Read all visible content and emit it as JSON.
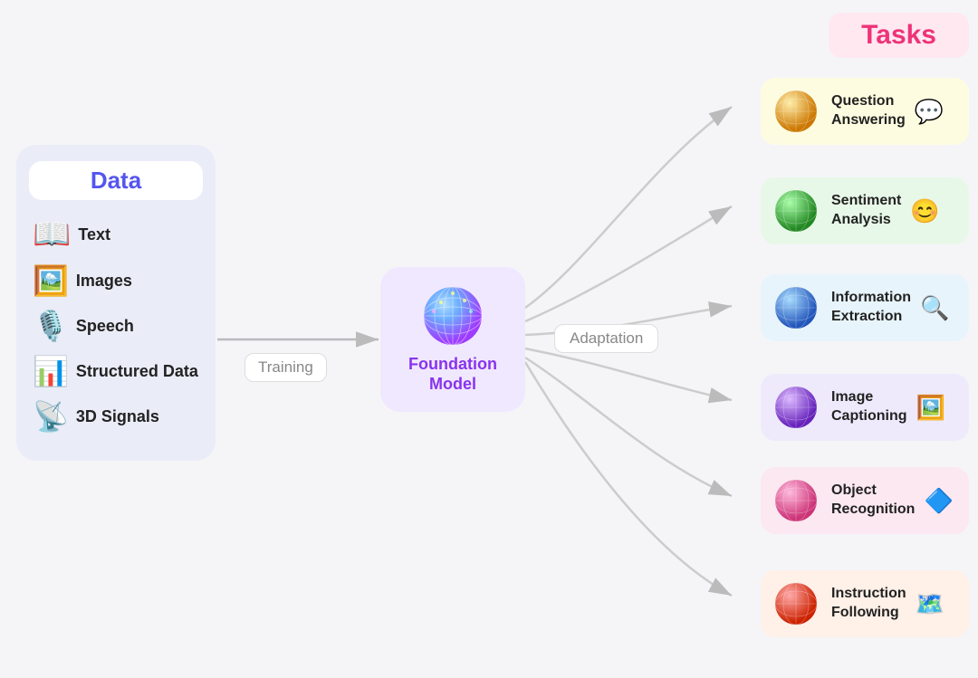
{
  "data_panel": {
    "title": "Data",
    "items": [
      {
        "label": "Text",
        "emoji": "📖"
      },
      {
        "label": "Images",
        "emoji": "🖼️"
      },
      {
        "label": "Speech",
        "emoji": "🎙️"
      },
      {
        "label": "Structured Data",
        "emoji": "📊"
      },
      {
        "label": "3D Signals",
        "emoji": "📡"
      }
    ]
  },
  "training_label": "Training",
  "foundation_model": {
    "label": "Foundation\nModel"
  },
  "adaptation_label": "Adaptation",
  "tasks_header": "Tasks",
  "tasks": [
    {
      "label": "Question\nAnswering",
      "emoji": "💬",
      "bg": "#fefce0",
      "sphere_color": "#e8a020"
    },
    {
      "label": "Sentiment\nAnalysis",
      "emoji": "😊",
      "bg": "#e8f8e8",
      "sphere_color": "#55cc44"
    },
    {
      "label": "Information\nExtraction",
      "emoji": "🔍",
      "bg": "#e8f4fb",
      "sphere_color": "#5599ee"
    },
    {
      "label": "Image\nCaptioning",
      "emoji": "🖼️",
      "bg": "#e8eafc",
      "sphere_color": "#8866dd"
    },
    {
      "label": "Object\nRecognition",
      "emoji": "🔷",
      "bg": "#fce8f0",
      "sphere_color": "#dd66aa"
    },
    {
      "label": "Instruction\nFollowing",
      "emoji": "🗺️",
      "bg": "#fff0e8",
      "sphere_color": "#ee5544"
    }
  ]
}
